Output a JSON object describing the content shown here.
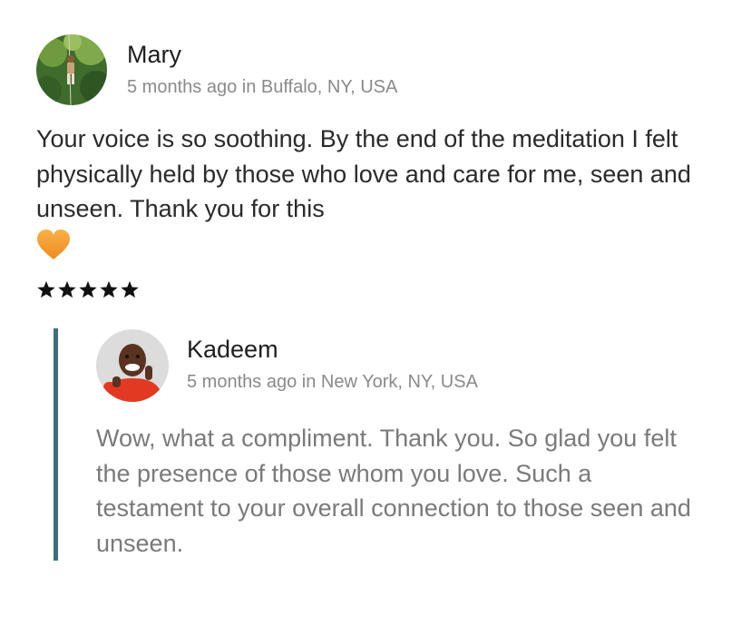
{
  "review": {
    "author": "Mary",
    "meta": "5 months ago in Buffalo, NY, USA",
    "text": "Your voice is so soothing. By the end of the meditation I felt physically held by those who love and care for me, seen and unseen. Thank you for this",
    "emoji_icon": "orange-heart-icon",
    "rating": 5,
    "rating_max": 5,
    "star_icon": "star-icon"
  },
  "reply": {
    "author": "Kadeem",
    "meta": "5 months ago in New York, NY, USA",
    "text": "Wow, what a compliment. Thank you. So glad you felt the presence of those whom you love. Such a testament to your overall connection to those seen and unseen."
  },
  "colors": {
    "reply_bar": "#3f6d78",
    "meta_text": "#8a8a8a",
    "reply_text": "#7a7a7a",
    "heart": "#f39a2c"
  }
}
